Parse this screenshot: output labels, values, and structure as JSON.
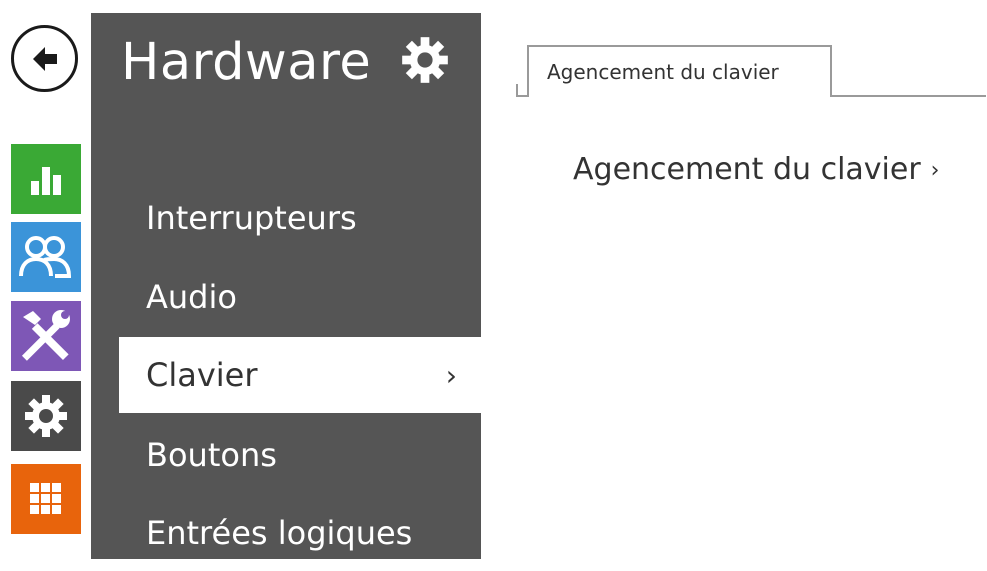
{
  "colors": {
    "panel": "#555555",
    "dashboard": "#3aa935",
    "users": "#3b94d9",
    "services": "#7e57b6",
    "settings": "#4a4a4a",
    "apps": "#e8640c"
  },
  "rail": {
    "back_icon": "arrow-left-icon",
    "items": [
      {
        "icon": "bar-chart-icon"
      },
      {
        "icon": "users-icon"
      },
      {
        "icon": "tools-icon"
      },
      {
        "icon": "gear-icon"
      },
      {
        "icon": "grid-icon"
      }
    ]
  },
  "panel": {
    "title": "Hardware",
    "title_icon": "gear-icon",
    "items": [
      {
        "label": "Interrupteurs",
        "active": false
      },
      {
        "label": "Audio",
        "active": false
      },
      {
        "label": "Clavier",
        "active": true
      },
      {
        "label": "Boutons",
        "active": false
      },
      {
        "label": "Entrées logiques",
        "active": false
      }
    ],
    "active_chevron": "›"
  },
  "content": {
    "tab_label": "Agencement du clavier",
    "section_title": "Agencement du clavier",
    "section_chevron": "›"
  }
}
